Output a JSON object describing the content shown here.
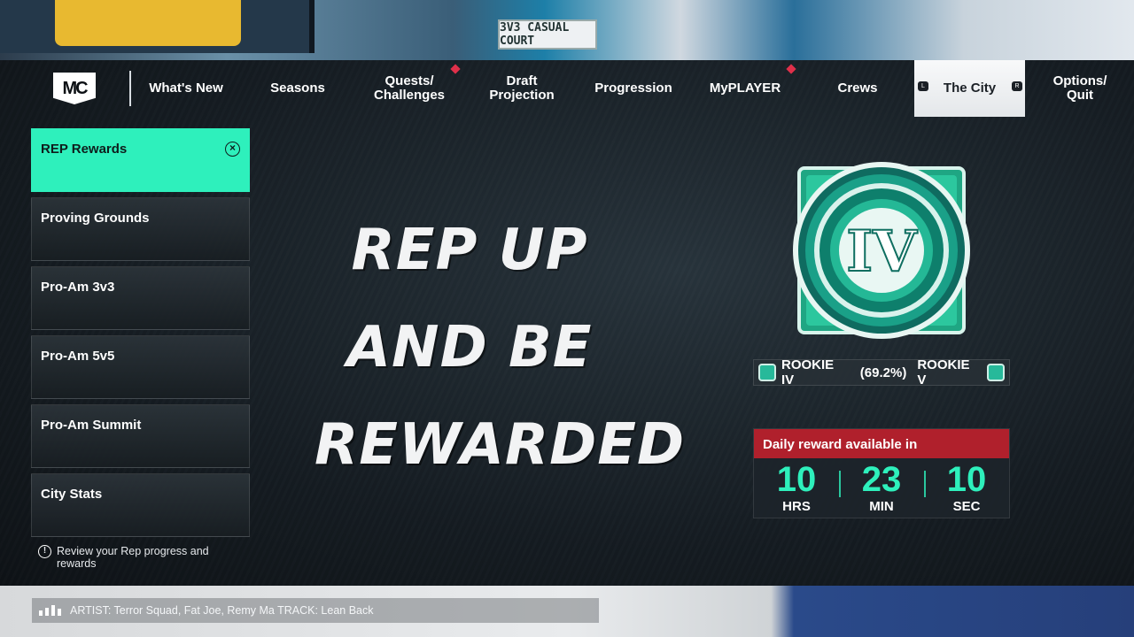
{
  "scene": {
    "court_sign": "3V3 CASUAL COURT"
  },
  "nav": {
    "logo": "MC",
    "items": [
      {
        "label": "What's New",
        "notification": false
      },
      {
        "label": "Seasons",
        "notification": false
      },
      {
        "label": "Quests/\nChallenges",
        "notification": true
      },
      {
        "label": "Draft\nProjection",
        "notification": false
      },
      {
        "label": "Progression",
        "notification": false
      },
      {
        "label": "MyPLAYER",
        "notification": true
      },
      {
        "label": "Crews",
        "notification": false
      },
      {
        "label": "The City",
        "notification": false,
        "active": true
      },
      {
        "label": "Options/\nQuit",
        "notification": false
      }
    ],
    "bumper_left": "L",
    "bumper_right": "R"
  },
  "menu": {
    "items": [
      {
        "label": "REP Rewards",
        "active": true
      },
      {
        "label": "Proving Grounds"
      },
      {
        "label": "Pro-Am 3v3"
      },
      {
        "label": "Pro-Am 5v5"
      },
      {
        "label": "Pro-Am Summit"
      },
      {
        "label": "City Stats"
      }
    ],
    "hint": "Review your Rep progress and rewards"
  },
  "hero": {
    "line1": "REP UP",
    "line2": "AND BE",
    "line3": "REWARDED"
  },
  "badge": {
    "numeral": "IV"
  },
  "rank": {
    "current": "ROOKIE IV",
    "progress": "(69.2%)",
    "next": "ROOKIE V"
  },
  "timer": {
    "title": "Daily reward available in",
    "hours": "10",
    "hours_label": "HRS",
    "minutes": "23",
    "minutes_label": "MIN",
    "seconds": "10",
    "seconds_label": "SEC"
  },
  "music": {
    "text": "ARTIST: Terror Squad, Fat Joe, Remy Ma  TRACK: Lean Back"
  },
  "colors": {
    "accent": "#2ef0bc",
    "timer_header": "#b0202c",
    "notification": "#e0304a"
  }
}
